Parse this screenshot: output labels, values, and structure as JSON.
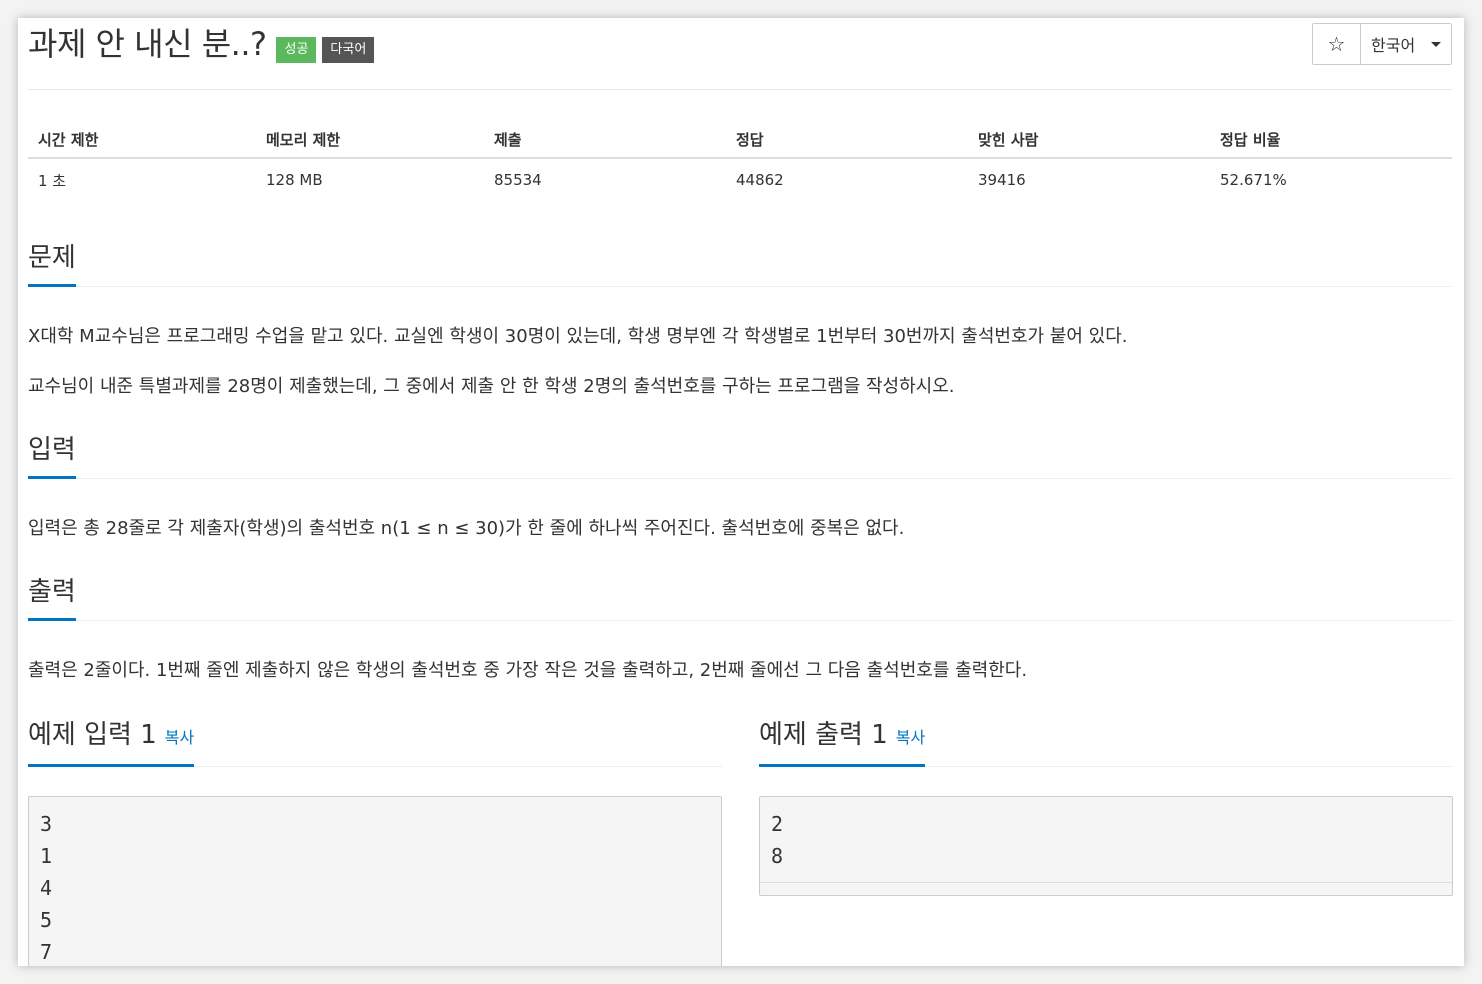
{
  "problem": {
    "title": "과제 안 내신 분..?",
    "badges": {
      "success": "성공",
      "multilang": "다국어"
    }
  },
  "toolbar": {
    "star_icon": "☆",
    "language": "한국어"
  },
  "info_table": {
    "headers": [
      "시간 제한",
      "메모리 제한",
      "제출",
      "정답",
      "맞힌 사람",
      "정답 비율"
    ],
    "values": [
      "1 초",
      "128 MB",
      "85534",
      "44862",
      "39416",
      "52.671%"
    ]
  },
  "sections": {
    "problem": {
      "title": "문제",
      "paragraphs": [
        "X대학 M교수님은 프로그래밍 수업을 맡고 있다. 교실엔 학생이 30명이 있는데, 학생 명부엔 각 학생별로 1번부터 30번까지 출석번호가 붙어 있다.",
        "교수님이 내준 특별과제를 28명이 제출했는데, 그 중에서 제출 안 한 학생 2명의 출석번호를 구하는 프로그램을 작성하시오."
      ]
    },
    "input": {
      "title": "입력",
      "text": "입력은 총 28줄로 각 제출자(학생)의 출석번호 n(1 ≤ n ≤ 30)가 한 줄에 하나씩 주어진다. 출석번호에 중복은 없다."
    },
    "output": {
      "title": "출력",
      "text": "출력은 2줄이다. 1번째 줄엔 제출하지 않은 학생의 출석번호 중 가장 작은 것을 출력하고, 2번째 줄에선 그 다음 출석번호를 출력한다."
    }
  },
  "samples": {
    "input": {
      "title": "예제 입력 1",
      "copy": "복사",
      "lines": [
        "3",
        "1",
        "4",
        "5",
        "7"
      ]
    },
    "output": {
      "title": "예제 출력 1",
      "copy": "복사",
      "lines": [
        "2",
        "8"
      ]
    }
  },
  "colors": {
    "accent": "#0076c0",
    "success": "#5cb85c",
    "multilang": "#555555"
  }
}
